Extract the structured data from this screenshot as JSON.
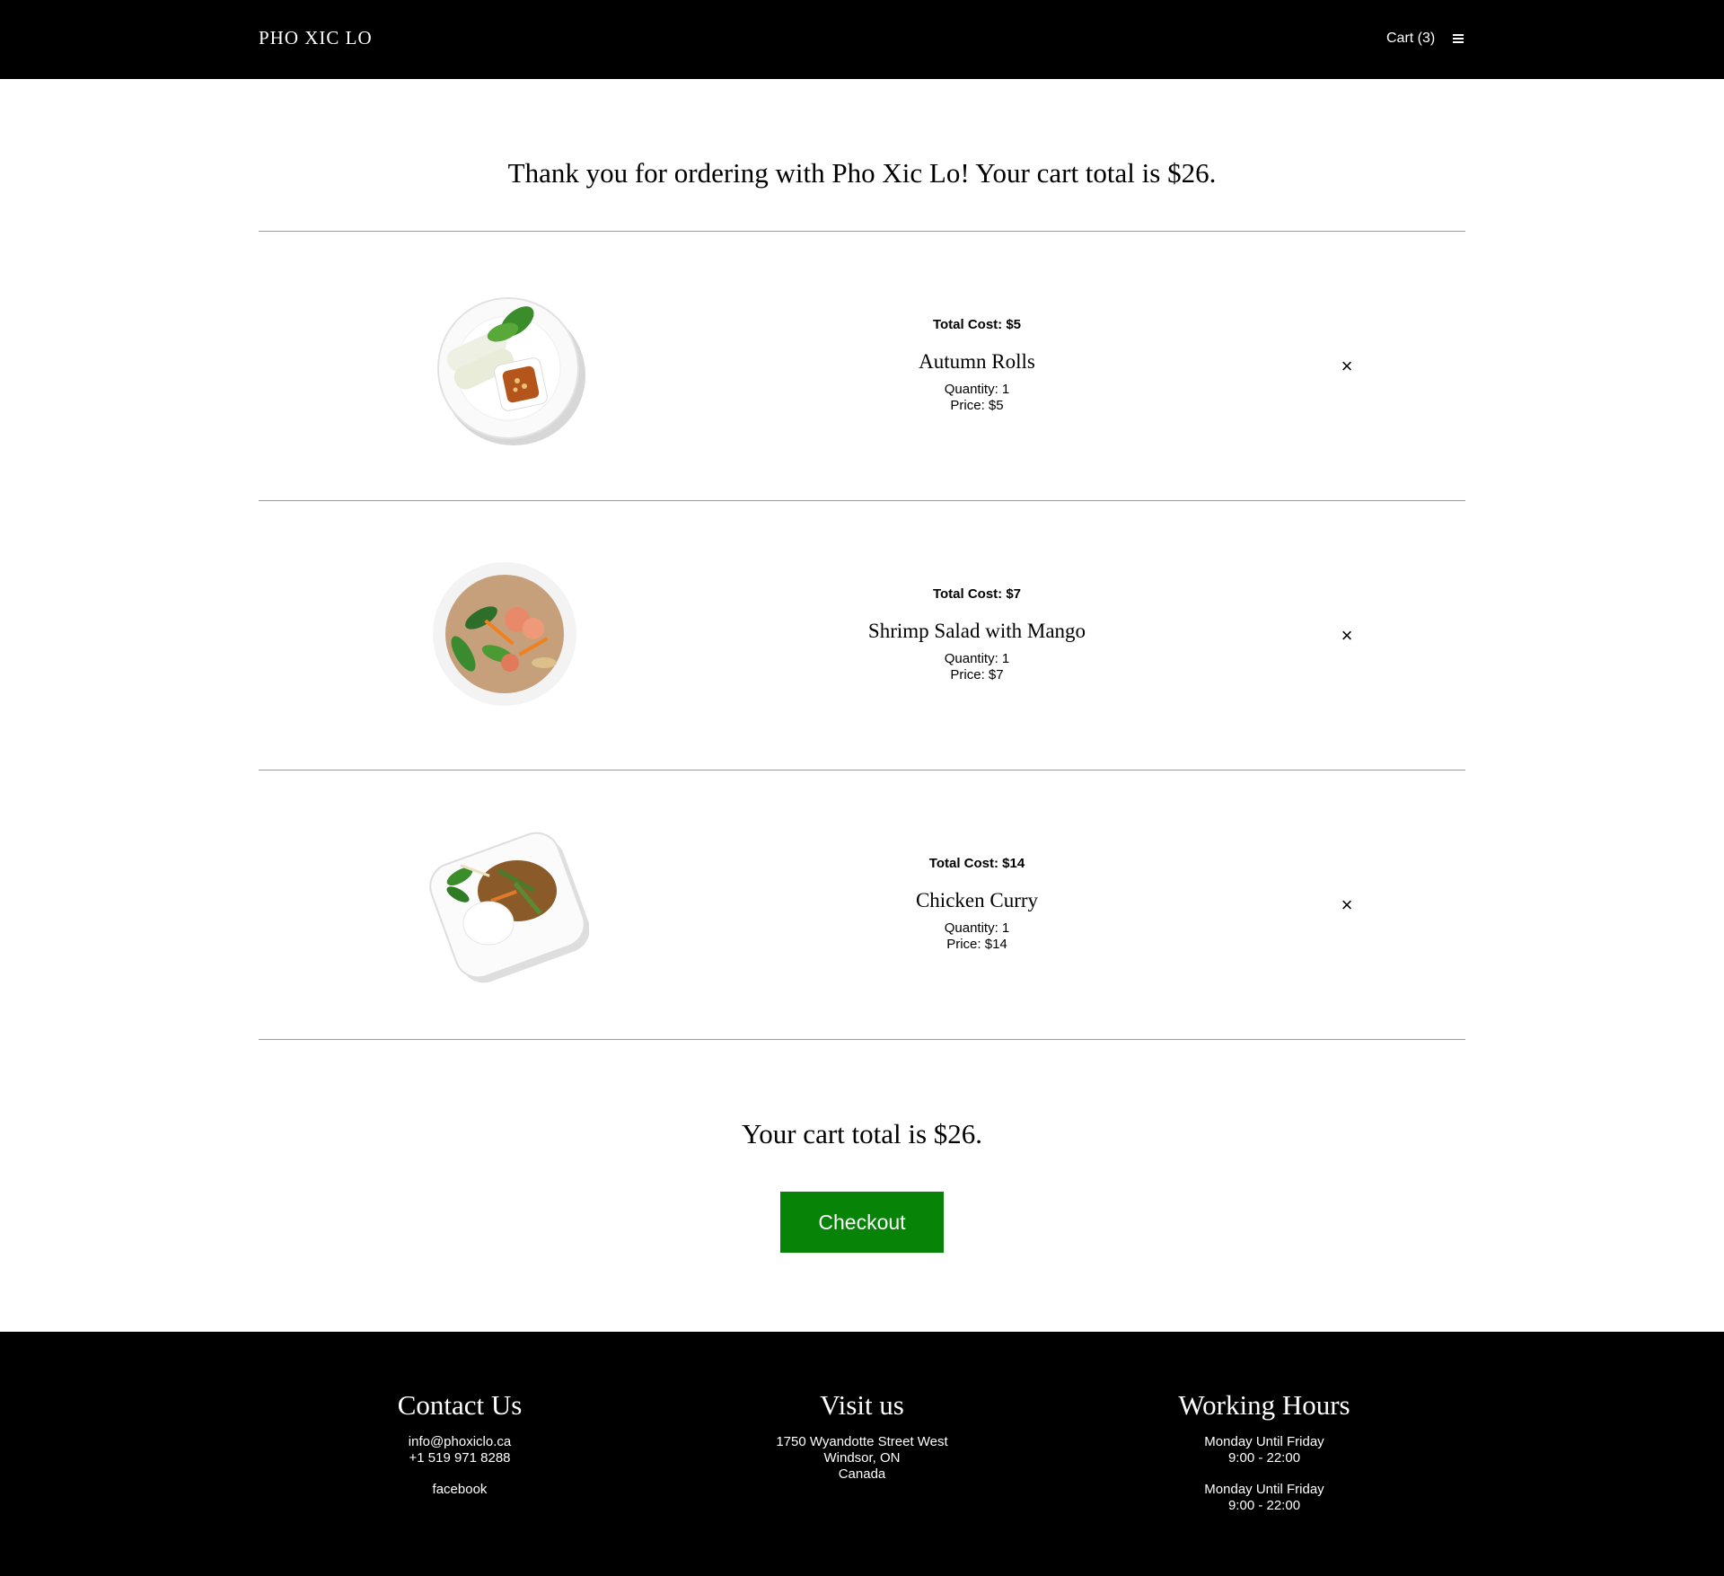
{
  "header": {
    "brand": "PHO XIC LO",
    "cart_label": "Cart (3)",
    "menu_icon": "hamburger-menu-icon"
  },
  "headline": "Thank you for ordering with Pho Xic Lo! Your cart total is $26.",
  "items": [
    {
      "cost": "Total Cost: $5",
      "name": "Autumn Rolls",
      "quantity": "Quantity: 1",
      "price": "Price: $5",
      "remove": "×"
    },
    {
      "cost": "Total Cost: $7",
      "name": "Shrimp Salad with Mango",
      "quantity": "Quantity: 1",
      "price": "Price: $7",
      "remove": "×"
    },
    {
      "cost": "Total Cost: $14",
      "name": "Chicken Curry",
      "quantity": "Quantity: 1",
      "price": "Price: $14",
      "remove": "×"
    }
  ],
  "summary": {
    "total_text": "Your cart total is $26.",
    "checkout_label": "Checkout",
    "checkout_color": "#078307"
  },
  "footer": {
    "contact": {
      "title": "Contact Us",
      "email": "info@phoxiclo.ca",
      "phone": "+1 519 971 8288",
      "social": "facebook"
    },
    "visit": {
      "title": "Visit us",
      "street": "1750 Wyandotte Street West",
      "city": "Windsor, ON",
      "country": "Canada"
    },
    "hours": {
      "title": "Working Hours",
      "rows": [
        {
          "days": "Monday Until Friday",
          "time": "9:00 - 22:00"
        },
        {
          "days": "Monday Until Friday",
          "time": "9:00 - 22:00"
        }
      ]
    }
  }
}
